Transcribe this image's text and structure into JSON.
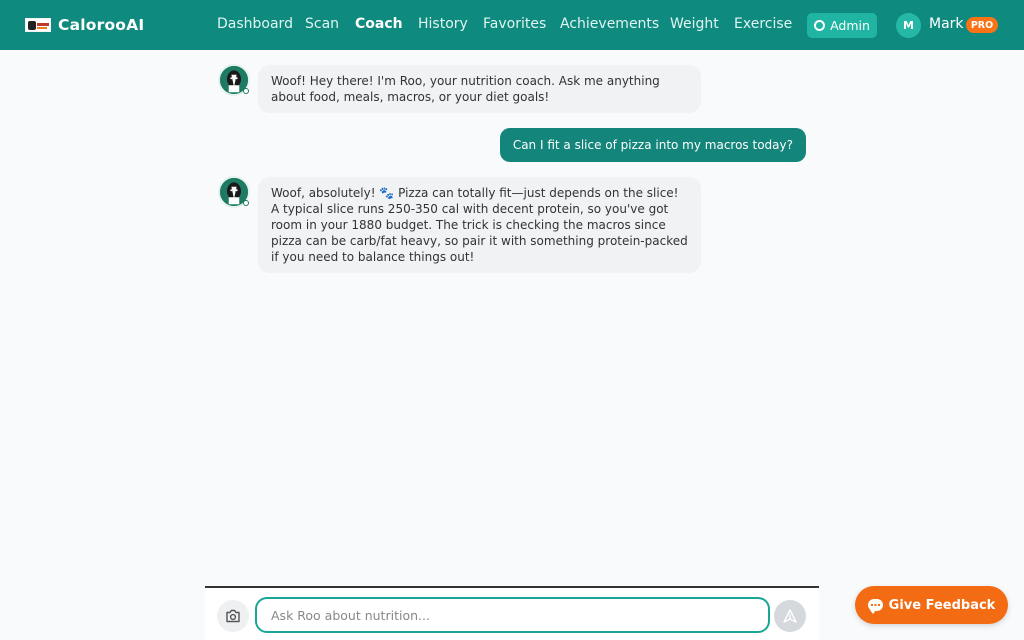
{
  "app": {
    "name": "CalorooAI"
  },
  "nav": {
    "items": [
      {
        "label": "Dashboard",
        "active": false
      },
      {
        "label": "Scan",
        "active": false
      },
      {
        "label": "Coach",
        "active": true
      },
      {
        "label": "History",
        "active": false
      },
      {
        "label": "Favorites",
        "active": false
      },
      {
        "label": "Achievements",
        "active": false
      },
      {
        "label": "Weight",
        "active": false
      },
      {
        "label": "Exercise",
        "active": false
      }
    ],
    "admin_label": "Admin",
    "admin_icon": "gear-icon"
  },
  "user": {
    "initial": "M",
    "name": "Mark",
    "badge": "PRO"
  },
  "chat": {
    "messages": [
      {
        "role": "coach",
        "text": "Woof! Hey there! I'm Roo, your nutrition coach. Ask me anything about food, meals, macros, or your diet goals!"
      },
      {
        "role": "user",
        "text": "Can I fit a slice of pizza into my macros today?"
      },
      {
        "role": "coach",
        "text": "Woof, absolutely! 🐾 Pizza can totally fit—just depends on the slice! A typical slice runs 250-350 cal with decent protein, so you've got room in your 1880 budget. The trick is checking the macros since pizza can be carb/fat heavy, so pair it with something protein-packed if you need to balance things out!"
      }
    ]
  },
  "input": {
    "placeholder": "Ask Roo about nutrition...",
    "value": ""
  },
  "feedback": {
    "label": "Give Feedback"
  },
  "colors": {
    "brand": "#0f8a7e",
    "accent": "#f36b13",
    "user_bubble": "#13857a"
  }
}
